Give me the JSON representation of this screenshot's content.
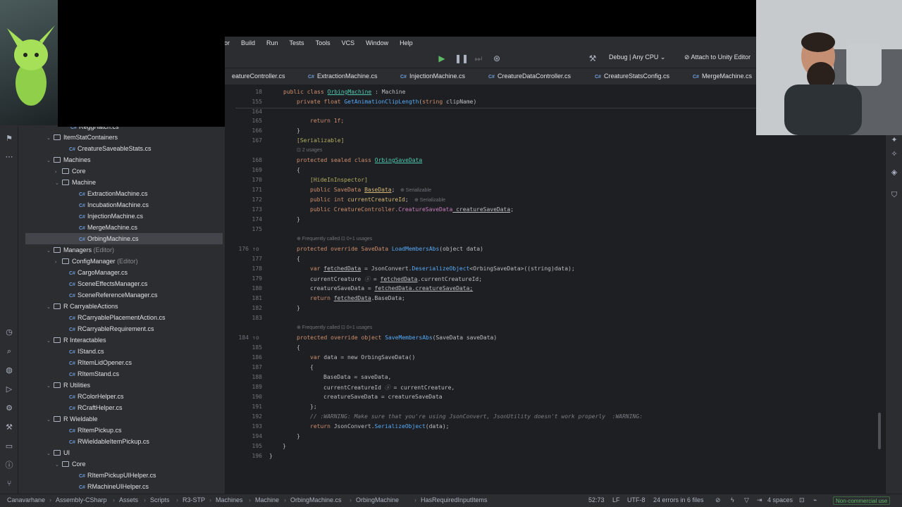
{
  "menu": [
    "or",
    "Build",
    "Run",
    "Tests",
    "Tools",
    "VCS",
    "Window",
    "Help"
  ],
  "toolbar": {
    "config": "Debug | Any CPU ⌄",
    "attach": "Attach to Unity Editor"
  },
  "tabs": [
    "eatureController.cs",
    "ExtractionMachine.cs",
    "InjectionMachine.cs",
    "CreatureDataController.cs",
    "CreatureStatsConfig.cs",
    "MergeMachine.cs"
  ],
  "tree": [
    {
      "label": "ReggHatch.cs",
      "kind": "file"
    },
    {
      "label": "ItemStatContainers",
      "kind": "folder"
    },
    {
      "label": "CreatureSaveableStats.cs",
      "kind": "file"
    },
    {
      "label": "Machines",
      "kind": "folder"
    },
    {
      "label": "Core",
      "kind": "folder"
    },
    {
      "label": "Machine",
      "kind": "folder"
    },
    {
      "label": "ExtractionMachine.cs",
      "kind": "file"
    },
    {
      "label": "IncubationMachine.cs",
      "kind": "file"
    },
    {
      "label": "InjectionMachine.cs",
      "kind": "file"
    },
    {
      "label": "MergeMachine.cs",
      "kind": "file"
    },
    {
      "label": "OrbingMachine.cs",
      "kind": "file"
    },
    {
      "label": "Managers",
      "hint": "(Editor)",
      "kind": "folder"
    },
    {
      "label": "ConfigManager",
      "hint": "(Editor)",
      "kind": "folder"
    },
    {
      "label": "CargoManager.cs",
      "kind": "file"
    },
    {
      "label": "SceneEffectsManager.cs",
      "kind": "file"
    },
    {
      "label": "SceneReferenceManager.cs",
      "kind": "file"
    },
    {
      "label": "R CarryableActions",
      "kind": "folder"
    },
    {
      "label": "RCarryablePlacementAction.cs",
      "kind": "file"
    },
    {
      "label": "RCarryableRequirement.cs",
      "kind": "file"
    },
    {
      "label": "R Interactables",
      "kind": "folder"
    },
    {
      "label": "IStand.cs",
      "kind": "file"
    },
    {
      "label": "RItemLidOpener.cs",
      "kind": "file"
    },
    {
      "label": "RItemStand.cs",
      "kind": "file"
    },
    {
      "label": "R Utilities",
      "kind": "folder"
    },
    {
      "label": "RColorHelper.cs",
      "kind": "file"
    },
    {
      "label": "RCraftHelper.cs",
      "kind": "file"
    },
    {
      "label": "R Wieldable",
      "kind": "folder"
    },
    {
      "label": "RItemPickup.cs",
      "kind": "file"
    },
    {
      "label": "RWieldableItemPickup.cs",
      "kind": "file"
    },
    {
      "label": "UI",
      "kind": "folder"
    },
    {
      "label": "Core",
      "kind": "folder"
    },
    {
      "label": "RItemPickupUIHelper.cs",
      "kind": "file"
    },
    {
      "label": "RMachineUIHelper.cs",
      "kind": "file"
    }
  ],
  "sticky": {
    "ln1": "18",
    "l1_a": "public class ",
    "l1_b": "OrbingMachine",
    "l1_c": " : Machine",
    "ln2": "155",
    "l2_a": "private float ",
    "l2_b": "GetAnimationClipLength",
    "l2_c": "(",
    "l2_d": "string",
    "l2_e": " clipName)"
  },
  "lines": {
    "n164": "164",
    "n165": "165",
    "n166": "166",
    "n167": "167",
    "n168": "168",
    "n169": "169",
    "n170": "170",
    "n171": "171",
    "n172": "172",
    "n173": "173",
    "n174": "174",
    "n175": "175",
    "n176": "176",
    "n177": "177",
    "n178": "178",
    "n179": "179",
    "n180": "180",
    "n181": "181",
    "n182": "182",
    "n183": "183",
    "n184": "184",
    "n185": "185",
    "n186": "186",
    "n187": "187",
    "n188": "188",
    "n189": "189",
    "n190": "190",
    "n191": "191",
    "n192": "192",
    "n193": "193",
    "n194": "194",
    "n195": "195",
    "n196": "196",
    "return1f": "return 1f;",
    "brace_close": "}",
    "brace_open": "{",
    "serializable": "[Serializable]",
    "usages2": "2 usages",
    "cls_a": "protected sealed class ",
    "cls_b": "OrbingSaveData",
    "hide": "[HideInInspector]",
    "f1_a": "public SaveData ",
    "f1_b": "BaseData",
    "f1_c": ";",
    "f1_hint": "⊕ Serializable",
    "f2_a": "public int ",
    "f2_b": "currentCreatureId",
    "f2_c": ";",
    "f2_hint": "⊕ Serializable",
    "f3_a": "public CreatureController.",
    "f3_b": "CreatureSaveData",
    "f3_c": " creatureSaveData",
    "f3_d": ";",
    "freq1": "⊕ Frequently called   ⊡ 0+1 usages",
    "load_a": "protected override SaveData ",
    "load_b": "LoadMembersAbs",
    "load_c": "(object data)",
    "l178_a": "var ",
    "l178_b": "fetchedData",
    "l178_c": " = JsonConvert.",
    "l178_d": "DeserializeObject",
    "l178_e": "<OrbingSaveData>((string)data);",
    "l179_a": "currentCreature ",
    "l179_b": "ⓐ",
    "l179_c": " = ",
    "l179_d": "fetchedData",
    "l179_e": ".currentCreatureId;",
    "l180_a": "creatureSaveData = ",
    "l180_b": "fetchedData",
    "l180_c": ".creatureSaveData;",
    "l181_a": "return ",
    "l181_b": "fetchedData",
    "l181_c": ".BaseData;",
    "freq2": "⊕ Frequently called   ⊡ 0+1 usages",
    "save_a": "protected override object ",
    "save_b": "SaveMembersAbs",
    "save_c": "(SaveData saveData)",
    "l186_a": "var ",
    "l186_b": "data",
    "l186_c": " = new OrbingSaveData()",
    "l188": "BaseData = saveData,",
    "l189_a": "currentCreatureId ",
    "l189_b": "ⓐ",
    "l189_c": " = currentCreature,",
    "l190": "creatureSaveData = creatureSaveData",
    "l191": "};",
    "l192": "// :WARNING: Make sure that you're using JsonConvert, JsonUtility doesn't work properly  :WARNING:",
    "l193_a": "return ",
    "l193_b": "JsonConvert.",
    "l193_c": "SerializeObject",
    "l193_d": "(data);"
  },
  "status": {
    "breadcrumb": [
      "Canavarhane",
      "Assembly-CSharp",
      "Assets",
      "Scripts",
      "R3-STP",
      "Machines",
      "Machine",
      "OrbingMachine.cs",
      "OrbingMachine",
      "HasRequiredInputItems"
    ],
    "pos": "52:73",
    "lf": "LF",
    "enc": "UTF-8",
    "errors": "24 errors in 6 files",
    "indent": "4 spaces",
    "license": "Non-commercial use"
  },
  "colors": {
    "bg": "#1e1f22",
    "panel": "#2b2d30",
    "keyword": "#cf8e6d",
    "type": "#4ec9b0",
    "method": "#57aaf7",
    "run": "#5fb865"
  }
}
